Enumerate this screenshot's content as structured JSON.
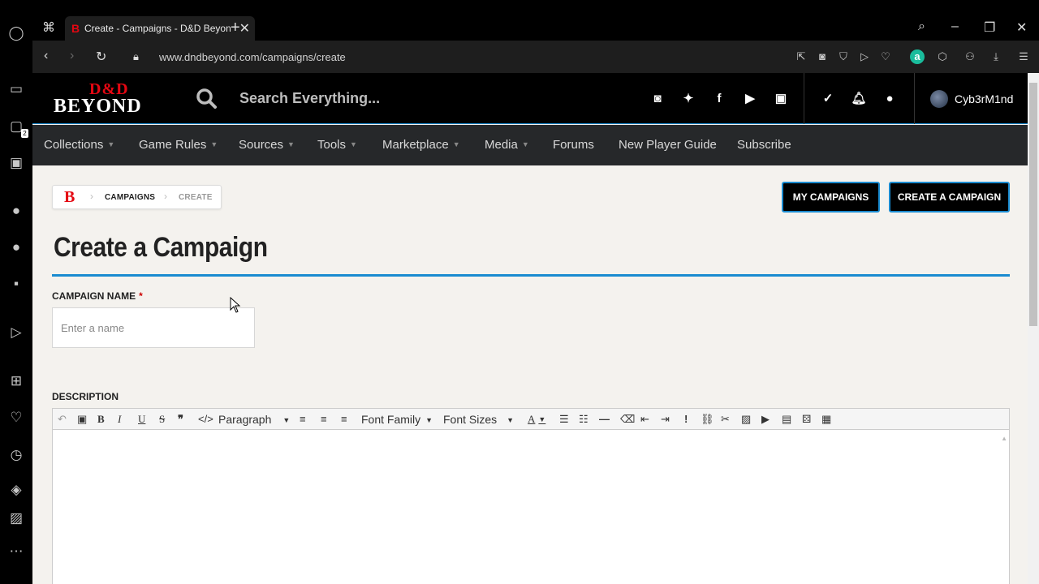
{
  "browser": {
    "tab_title": "Create - Campaigns - D&D Beyond",
    "url": "www.dndbeyond.com/campaigns/create",
    "sidebar_badge": "2"
  },
  "site": {
    "logo_top": "D&D",
    "logo_bottom": "BEYOND",
    "search_placeholder": "Search Everything...",
    "user_name": "Cyb3rM1nd",
    "nav": [
      "Collections",
      "Game Rules",
      "Sources",
      "Tools",
      "Marketplace",
      "Media",
      "Forums",
      "New Player Guide",
      "Subscribe"
    ]
  },
  "breadcrumb": {
    "logo": "B",
    "items": [
      "CAMPAIGNS",
      "CREATE"
    ]
  },
  "buttons": {
    "my_campaigns": "MY CAMPAIGNS",
    "create_campaign": "CREATE A CAMPAIGN"
  },
  "page": {
    "title": "Create a Campaign",
    "name_label": "CAMPAIGN NAME",
    "required_mark": "*",
    "name_placeholder": "Enter a name",
    "description_label": "DESCRIPTION"
  },
  "editor": {
    "paragraph": "Paragraph",
    "font_family": "Font Family",
    "font_sizes": "Font Sizes"
  },
  "colors": {
    "accent": "#1a8bd0",
    "brand_red": "#e40712"
  }
}
